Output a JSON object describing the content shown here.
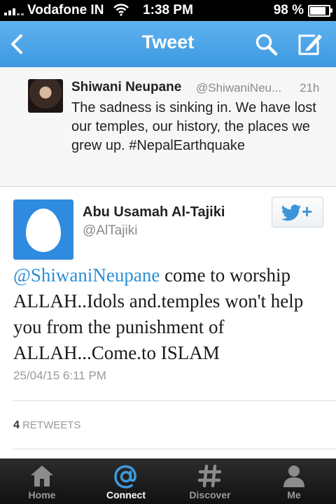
{
  "status_bar": {
    "carrier": "Vodafone IN",
    "time": "1:38 PM",
    "battery": "98 %",
    "battery_level": 0.98
  },
  "nav": {
    "title": "Tweet",
    "accent": "#4aa6ea"
  },
  "parent_tweet": {
    "name": "Shiwani Neupane",
    "handle": "@ShiwaniNeu...",
    "time": "21h",
    "text": "The sadness is sinking in. We have lost our temples, our history, the places we grew up. #NepalEarthquake"
  },
  "main_tweet": {
    "name": "Abu Usamah Al-Tajiki",
    "handle": "@AlTajiki",
    "mention": "@ShiwaniNeupane",
    "text": " come to worship ALLAH..Idols and.temples won't help you from the punishment of ALLAH...Come.to ISLAM",
    "date": "25/04/15 6:11 PM",
    "retweet_count": "4",
    "retweet_label": "RETWEETS",
    "follow_icon": "follow-bird-plus-icon",
    "follow_label": "+"
  },
  "tabs": [
    {
      "label": "Home",
      "icon": "home-icon"
    },
    {
      "label": "Connect",
      "icon": "at-icon"
    },
    {
      "label": "Discover",
      "icon": "hash-icon"
    },
    {
      "label": "Me",
      "icon": "person-icon"
    }
  ],
  "active_tab": "Connect"
}
